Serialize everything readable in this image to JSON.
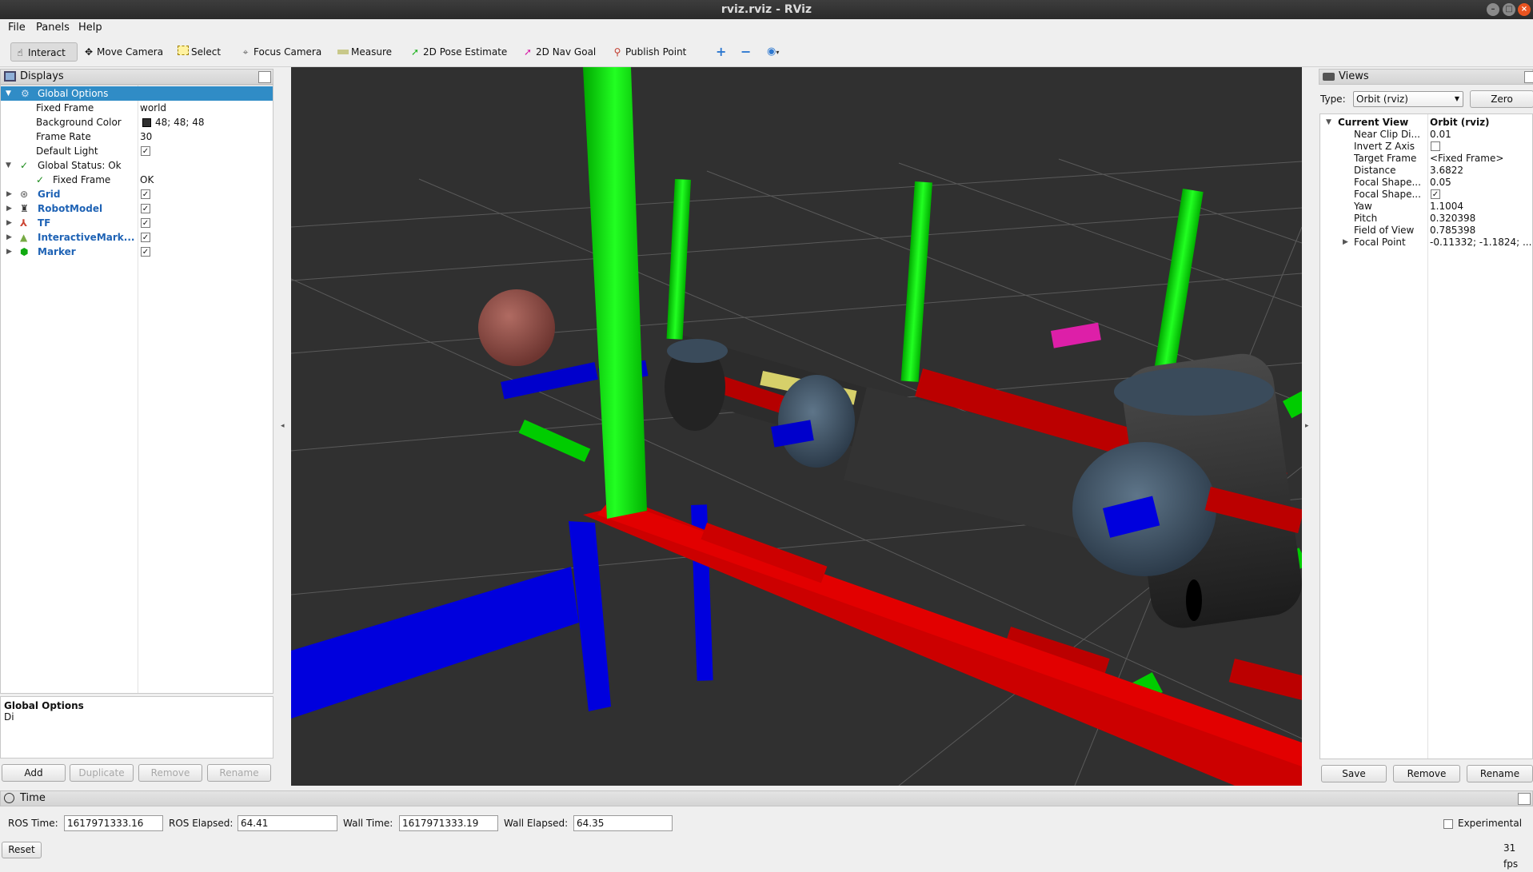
{
  "window": {
    "title": "rviz.rviz - RViz"
  },
  "menu": {
    "file": "File",
    "panels": "Panels",
    "help": "Help"
  },
  "toolbar": {
    "interact": "Interact",
    "move_camera": "Move Camera",
    "select": "Select",
    "focus_camera": "Focus Camera",
    "measure": "Measure",
    "pose_estimate": "2D Pose Estimate",
    "nav_goal": "2D Nav Goal",
    "publish_point": "Publish Point"
  },
  "displays": {
    "title": "Displays",
    "rows": {
      "global_options": "Global Options",
      "fixed_frame_label": "Fixed Frame",
      "fixed_frame_value": "world",
      "background_color_label": "Background Color",
      "background_color_value": "48; 48; 48",
      "frame_rate_label": "Frame Rate",
      "frame_rate_value": "30",
      "default_light_label": "Default Light",
      "global_status_label": "Global Status: Ok",
      "status_fixed_frame_label": "Fixed Frame",
      "status_fixed_frame_value": "OK",
      "grid": "Grid",
      "robot_model": "RobotModel",
      "tf": "TF",
      "interactive_markers": "InteractiveMark...",
      "marker": "Marker"
    },
    "description_title": "Global Options",
    "description_text": "Di",
    "buttons": {
      "add": "Add",
      "duplicate": "Duplicate",
      "remove": "Remove",
      "rename": "Rename"
    }
  },
  "views": {
    "title": "Views",
    "type_label": "Type:",
    "type_value": "Orbit (rviz)",
    "zero_button": "Zero",
    "rows": {
      "current_view_label": "Current View",
      "current_view_value": "Orbit (rviz)",
      "near_clip_label": "Near Clip Di...",
      "near_clip_value": "0.01",
      "invert_z_label": "Invert Z Axis",
      "target_frame_label": "Target Frame",
      "target_frame_value": "<Fixed Frame>",
      "distance_label": "Distance",
      "distance_value": "3.6822",
      "focal_shape_size_label": "Focal Shape...",
      "focal_shape_size_value": "0.05",
      "focal_shape_fixed_label": "Focal Shape...",
      "yaw_label": "Yaw",
      "yaw_value": "1.1004",
      "pitch_label": "Pitch",
      "pitch_value": "0.320398",
      "fov_label": "Field of View",
      "fov_value": "0.785398",
      "focal_point_label": "Focal Point",
      "focal_point_value": "-0.11332; -1.1824; ..."
    },
    "buttons": {
      "save": "Save",
      "remove": "Remove",
      "rename": "Rename"
    }
  },
  "time": {
    "title": "Time",
    "ros_time_label": "ROS Time:",
    "ros_time_value": "1617971333.16",
    "ros_elapsed_label": "ROS Elapsed:",
    "ros_elapsed_value": "64.41",
    "wall_time_label": "Wall Time:",
    "wall_time_value": "1617971333.19",
    "wall_elapsed_label": "Wall Elapsed:",
    "wall_elapsed_value": "64.35",
    "experimental_label": "Experimental",
    "reset_button": "Reset",
    "fps": "31 fps"
  },
  "colors": {
    "background": "#303030",
    "selection": "#308cc6",
    "axis_x": "#cc0000",
    "axis_y": "#00dd00",
    "axis_z": "#0000dd"
  }
}
